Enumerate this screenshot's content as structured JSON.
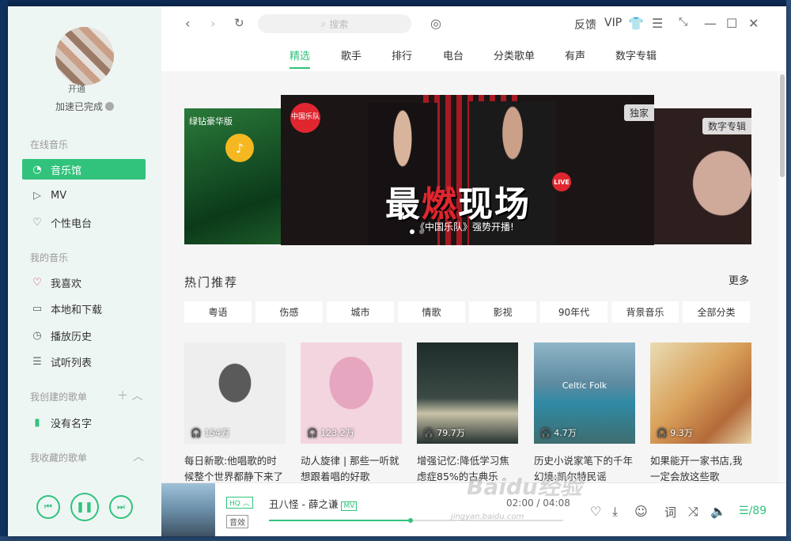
{
  "sidebar": {
    "avatar_tag": "开通",
    "accel_status": "加速已完成",
    "online_music": "在线音乐",
    "online_items": [
      "音乐馆",
      "MV",
      "个性电台"
    ],
    "my_music": "我的音乐",
    "my_items": [
      "我喜欢",
      "本地和下载",
      "播放历史",
      "试听列表"
    ],
    "created_playlists": "我创建的歌单",
    "created_items": [
      "没有名字"
    ],
    "collected_playlists": "我收藏的歌单"
  },
  "topbar": {
    "search_placeholder": "搜索",
    "feedback": "反馈",
    "vip": "VIP"
  },
  "tabs": [
    "精选",
    "歌手",
    "排行",
    "电台",
    "分类歌单",
    "有声",
    "数字专辑"
  ],
  "banner": {
    "left_tag": "绿钻豪华版",
    "exclusive": "独家",
    "digital_album": "数字专辑",
    "logo_text": "中国乐队",
    "live": "LIVE",
    "title_a": "最",
    "title_hot": "燃",
    "title_b": "现场",
    "subtitle": "《中国乐队》强势开播!"
  },
  "recommend": {
    "title": "热门推荐",
    "more": "更多",
    "categories": [
      "粤语",
      "伤感",
      "城市",
      "情歌",
      "影视",
      "90年代",
      "背景音乐",
      "全部分类"
    ],
    "cards": [
      {
        "plays": "154万",
        "title": "每日新歌:他唱歌的时候整个世界都静下来了"
      },
      {
        "plays": "123.2万",
        "title": "动人旋律 | 那些一听就想跟着唱的好歌"
      },
      {
        "plays": "79.7万",
        "title": "增强记忆:降低学习焦虑症85%的古典乐"
      },
      {
        "plays": "4.7万",
        "title": "历史小说家笔下的千年幻境:凯尔特民谣",
        "overlay": "Celtic Folk"
      },
      {
        "plays": "9.3万",
        "title": "如果能开一家书店,我一定会放这些歌"
      }
    ]
  },
  "player": {
    "hq": "HQ",
    "effect": "音效",
    "song": "丑八怪 - 薛之谦",
    "mv": "MV",
    "time": "02:00 / 04:08",
    "progress": 0.48,
    "lyric": "词",
    "playlist_count": "89"
  },
  "watermark": {
    "main": "Baidu经验",
    "sub": "jingyan.baidu.com"
  },
  "colors": {
    "accent": "#31c27c",
    "sidebar_bg": "#eef6f4"
  }
}
